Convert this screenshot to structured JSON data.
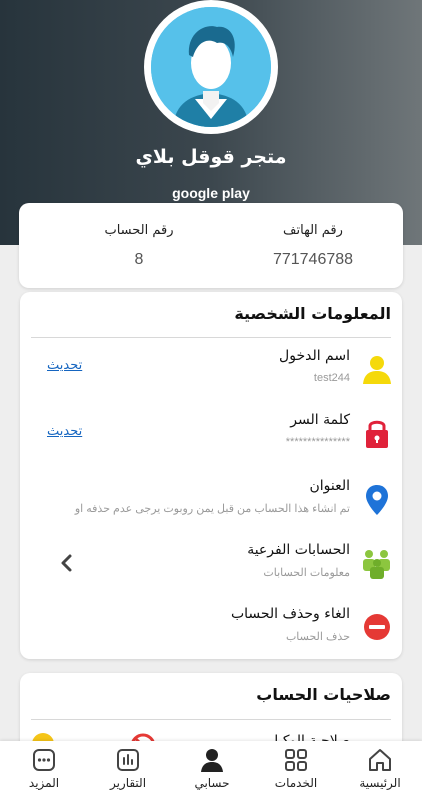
{
  "profile": {
    "store_name": "متجر قوقل بلاي",
    "store_subtitle": "google play"
  },
  "stats": {
    "phone_label": "رقم الهاتف",
    "phone_value": "771746788",
    "account_label": "رقم الحساب",
    "account_value": "8"
  },
  "personal_info": {
    "title": "المعلومات الشخصية",
    "rows": [
      {
        "title": "اسم الدخول",
        "subtitle": "test244",
        "action": "تحديث",
        "icon": "user-icon"
      },
      {
        "title": "كلمة السر",
        "subtitle": "***************",
        "action": "تحديث",
        "icon": "lock-icon"
      },
      {
        "title": "العنوان",
        "subtitle": "تم انشاء هذا الحساب من قبل يمن روبوت يرجى  عدم حذفه او",
        "icon": "location-pin-icon"
      },
      {
        "title": "الحسابات الفرعية",
        "subtitle": "معلومات الحسابات",
        "icon": "group-icon"
      },
      {
        "title": "الغاء وحذف الحساب",
        "subtitle": "حذف الحساب",
        "icon": "minus-circle-icon"
      }
    ]
  },
  "permissions": {
    "title": "صلاحيات الحساب",
    "first_row_partial": "صلاحية الوكيل"
  },
  "nav": {
    "items": [
      {
        "label": "الرئيسية",
        "icon": "home-icon"
      },
      {
        "label": "الخدمات",
        "icon": "grid-icon"
      },
      {
        "label": "حسابي",
        "icon": "person-icon",
        "active": true
      },
      {
        "label": "التقارير",
        "icon": "report-icon"
      },
      {
        "label": "المزيد",
        "icon": "more-icon"
      }
    ]
  },
  "colors": {
    "header_dark": "#27343c",
    "header_light": "#6f7679",
    "avatar_bg": "#56c1ea",
    "link_blue": "#1565c0",
    "user_yellow": "#f5d90a",
    "lock_red": "#e0223a",
    "pin_blue": "#1e73d8",
    "group_green": "#8cc63f",
    "delete_red": "#e53935"
  }
}
